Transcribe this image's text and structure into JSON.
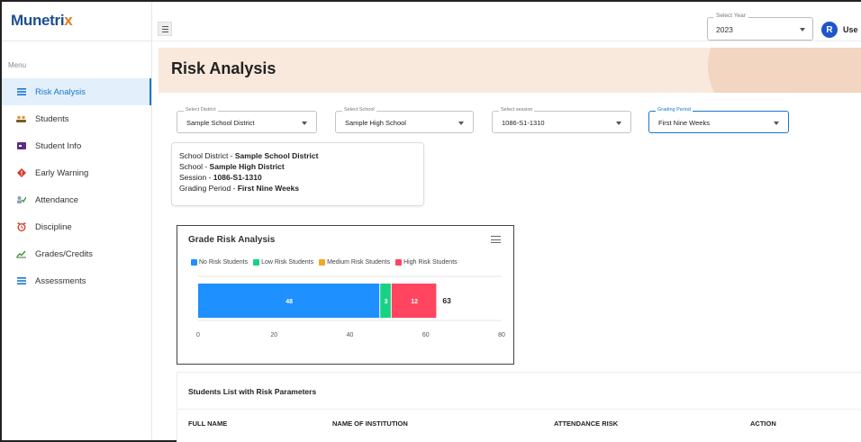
{
  "app": {
    "logo_text": "Munetri",
    "logo_accent": "x"
  },
  "sidebar": {
    "menu_label": "Menu",
    "items": [
      {
        "label": "Risk Analysis",
        "icon": "list-icon",
        "active": true
      },
      {
        "label": "Students",
        "icon": "group-icon"
      },
      {
        "label": "Student Info",
        "icon": "id-card-icon"
      },
      {
        "label": "Early Warning",
        "icon": "warning-diamond-icon"
      },
      {
        "label": "Attendance",
        "icon": "attendance-icon"
      },
      {
        "label": "Discipline",
        "icon": "alarm-clock-icon"
      },
      {
        "label": "Grades/Credits",
        "icon": "chart-line-icon"
      },
      {
        "label": "Assessments",
        "icon": "list-icon"
      }
    ]
  },
  "topbar": {
    "year_label": "Select Year",
    "year_value": "2023",
    "avatar_letter": "R",
    "user_text": "Use"
  },
  "page": {
    "title": "Risk Analysis"
  },
  "filters": {
    "district": {
      "label": "Select District",
      "value": "Sample School District"
    },
    "school": {
      "label": "Select School",
      "value": "Sample High School"
    },
    "session": {
      "label": "Select session",
      "value": "1086-S1-1310"
    },
    "period": {
      "label": "Grading Period",
      "value": "First Nine Weeks"
    }
  },
  "info": {
    "district_label": "School District - ",
    "district_value": "Sample School District",
    "school_label": "School - ",
    "school_value": "Sample High District",
    "session_label": "Session - ",
    "session_value": "1086-S1-1310",
    "period_label": "Grading Period - ",
    "period_value": "First Nine Weeks"
  },
  "chart_data": {
    "type": "bar",
    "orientation": "horizontal",
    "stacked": true,
    "title": "Grade Risk Analysis",
    "series": [
      {
        "name": "No Risk Students",
        "values": [
          48
        ],
        "color": "#1e90ff"
      },
      {
        "name": "Low Risk Students",
        "values": [
          3
        ],
        "color": "#16d382"
      },
      {
        "name": "Medium Risk Students",
        "values": [
          0
        ],
        "color": "#f4a71c"
      },
      {
        "name": "High Risk Students",
        "values": [
          12
        ],
        "color": "#ff4560"
      }
    ],
    "total_label": "63",
    "xlim": [
      0,
      80
    ],
    "xticks": [
      "0",
      "20",
      "40",
      "60",
      "80"
    ],
    "grid": true,
    "legend_position": "top-left"
  },
  "students": {
    "title": "Students List with Risk Parameters",
    "columns": [
      "FULL NAME",
      "NAME OF INSTITUTION",
      "ATTENDANCE RISK",
      "ACTION"
    ]
  }
}
